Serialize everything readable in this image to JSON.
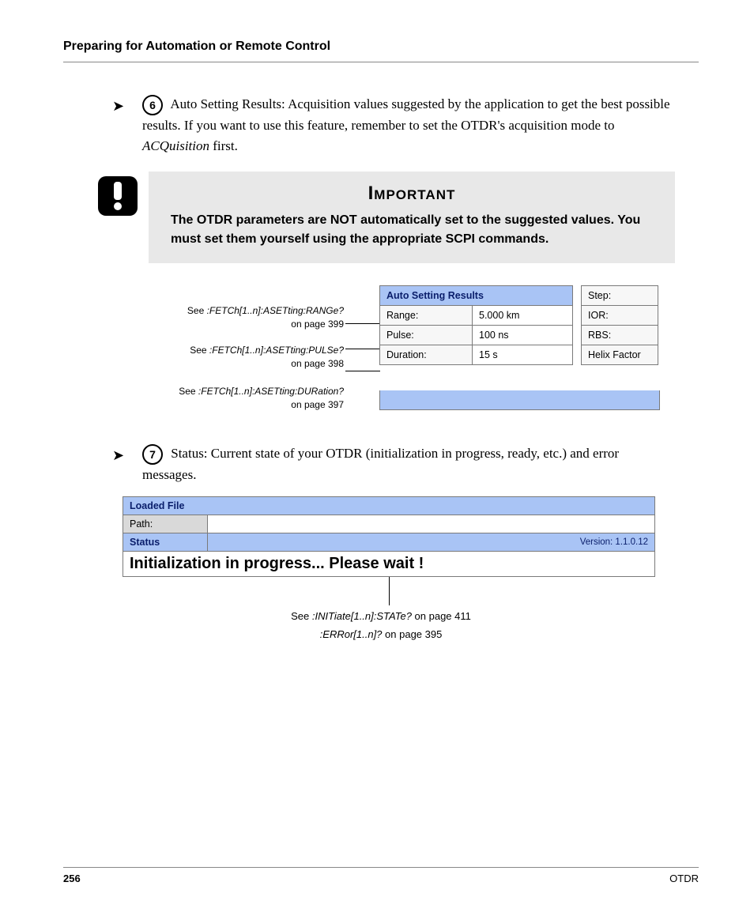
{
  "header": {
    "section_title": "Preparing for Automation or Remote Control"
  },
  "item6": {
    "num": "6",
    "lead": "Auto Setting Results: Acquisition values suggested by the application to get the best possible results. If you want to use this feature, remember to set the OTDR's acquisition mode to ",
    "italic": "ACQuisition",
    "tail": " first."
  },
  "important": {
    "title": "Important",
    "body": "The OTDR parameters are NOT automatically set to the suggested values. You must set them yourself using the appropriate SCPI commands."
  },
  "captions": {
    "c1": {
      "pre": "See ",
      "cmd": ":FETCh[1..n]:ASETting:RANGe?",
      "post": "on page 399"
    },
    "c2": {
      "pre": "See ",
      "cmd": ":FETCh[1..n]:ASETting:PULSe?",
      "post": "on page 398"
    },
    "c3": {
      "pre": "See ",
      "cmd": ":FETCh[1..n]:ASETting:DURation?",
      "post": "on page 397"
    }
  },
  "asr": {
    "title": "Auto Setting Results",
    "rows": [
      {
        "label": "Range:",
        "value": "5.000 km"
      },
      {
        "label": "Pulse:",
        "value": "100 ns"
      },
      {
        "label": "Duration:",
        "value": "15 s"
      }
    ],
    "right": [
      "Step:",
      "IOR:",
      "RBS:",
      "Helix Factor"
    ]
  },
  "item7": {
    "num": "7",
    "text": "Status: Current state of your OTDR (initialization in progress, ready, etc.) and error messages."
  },
  "status_panel": {
    "loaded_file": "Loaded File",
    "path_label": "Path:",
    "path_value": "",
    "status_label": "Status",
    "version_label": "Version:  1.1.0.12",
    "message": "Initialization in progress...  Please wait !"
  },
  "lower": {
    "l1": {
      "pre": "See ",
      "cmd": ":INITiate[1..n]:STATe?",
      "post": " on page 411"
    },
    "l2": {
      "cmd": ":ERRor[1..n]?",
      "post": " on page 395"
    }
  },
  "footer": {
    "page": "256",
    "product": "OTDR"
  }
}
